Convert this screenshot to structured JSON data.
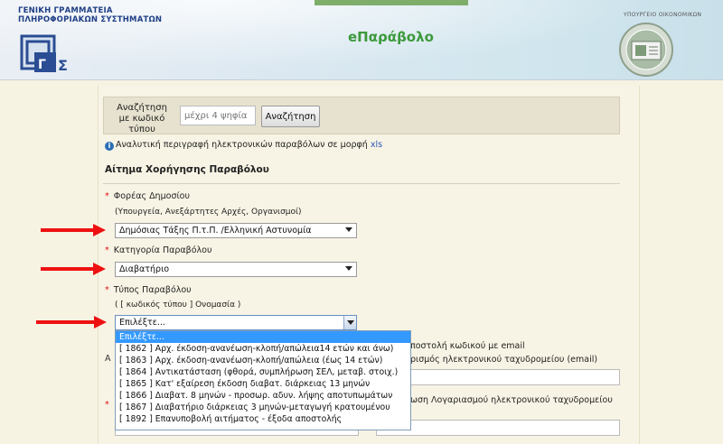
{
  "header": {
    "org_line1": "ΓΕΝΙΚΗ ΓΡΑΜΜΑΤΕΙΑ",
    "org_line2": "ΠΛΗΡΟΦΟΡΙΑΚΩΝ ΣΥΣΤΗΜΑΤΩΝ",
    "app_title": "eΠαράβολο",
    "ministry": "ΥΠΟΥΡΓΕΙΟ ΟΙΚΟΝΟΜΙΚΩΝ"
  },
  "search": {
    "label": "Αναζήτηση με κωδικό τύπου",
    "placeholder": "μέχρι 4 ψηφία",
    "button": "Αναζήτηση"
  },
  "info": {
    "text": "Αναλυτική περιγραφή ηλεκτρονικών παραβόλων σε μορφή",
    "link": "xls"
  },
  "form": {
    "section_title": "Αίτημα Χορήγησης Παραβόλου",
    "required_mark": "*",
    "agency": {
      "label": "Φορέας Δημοσίου",
      "hint": "(Υπουργεία, Ανεξάρτητες Αρχές, Οργανισμοί)",
      "value": "Δημόσιας Τάξης Π.τ.Π. /Ελληνική Αστυνομία"
    },
    "category": {
      "label": "Κατηγορία Παραβόλου",
      "value": "Διαβατήριο"
    },
    "type": {
      "label": "Τύπος Παραβόλου",
      "hint": "( [ κωδικός τύπου ] Ονομασία )",
      "value": "Επιλέξτε..."
    },
    "email_partial": {
      "line1": "ποστολή κωδικού με email",
      "line2": "ρισμός ηλεκτρονικού ταχυδρομείου (email)",
      "line3": "ωση Λογαριασμού ηλεκτρονικού ταχυδρομείου"
    }
  },
  "dropdown": {
    "items": [
      "Επιλέξτε...",
      "[ 1862 ] Αρχ. έκδοση-ανανέωση-κλοπή/απώλεια14 ετών και άνω)",
      "[ 1863 ] Αρχ. έκδοση-ανανέωση-κλοπή/απώλεια (έως 14 ετών)",
      "[ 1864 ] Αντικατάσταση (φθορά, συμπλήρωση ΣΕΛ, μεταβ. στοιχ.)",
      "[ 1865 ] Κατ' εξαίρεση έκδοση διαβατ. διάρκειας 13 μηνών",
      "[ 1866 ] Διαβατ. 8 μηνών - προσωρ. αδυν. λήψης αποτυπωμάτων",
      "[ 1867 ] Διαβατήριο διάρκειας 3 μηνών-μεταγωγή κρατουμένου",
      "[ 1892 ] Επανυποβολή αιτήματος - έξοδα αποστολής"
    ]
  },
  "colors": {
    "background": "#f6f3e3",
    "title_green": "#3c9a3c",
    "header_blue": "#1f3f86",
    "arrow_red": "#e11111",
    "selection_blue": "#3399ff"
  }
}
